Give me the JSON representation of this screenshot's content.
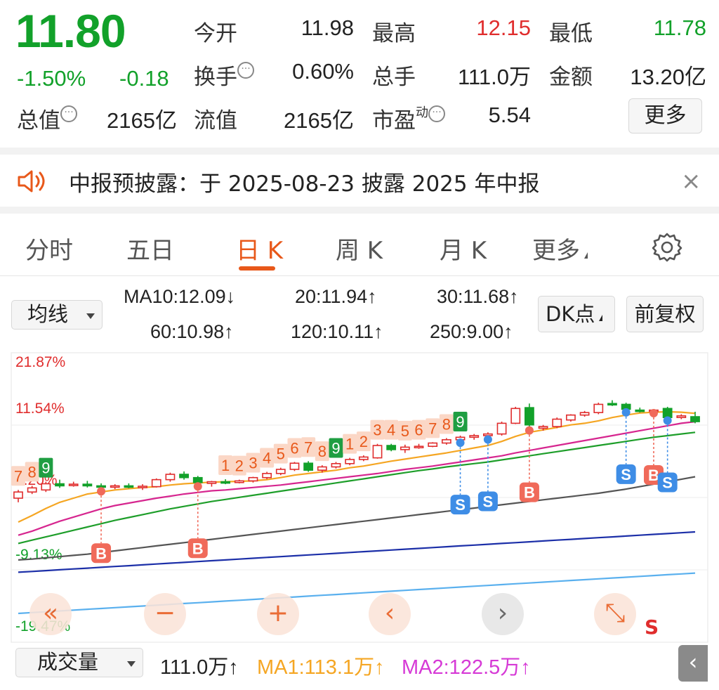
{
  "quote": {
    "price": "11.80",
    "change_pct": "-1.50%",
    "change_amt": "-0.18",
    "fields": [
      {
        "label": "今开",
        "value": "11.98"
      },
      {
        "label": "最高",
        "value": "12.15"
      },
      {
        "label": "最低",
        "value": "11.78"
      },
      {
        "label": "换手",
        "value": "0.60%"
      },
      {
        "label": "总手",
        "value": "111.0万"
      },
      {
        "label": "金额",
        "value": "13.20亿"
      },
      {
        "label": "总值",
        "value": "2165亿"
      },
      {
        "label": "流值",
        "value": "2165亿"
      },
      {
        "label": "市盈",
        "value": "5.54"
      }
    ],
    "pe_superscript": "动",
    "info_glyph": "···",
    "more_label": "更多"
  },
  "notice": {
    "icon": "speaker-icon",
    "text": "中报预披露：于 2025-08-23 披露 2025 年中报",
    "close_glyph": "×"
  },
  "tabs": [
    {
      "label": "分时"
    },
    {
      "label": "五日"
    },
    {
      "label": "日 K",
      "active": true
    },
    {
      "label": "周 K"
    },
    {
      "label": "月 K"
    },
    {
      "label": "更多"
    }
  ],
  "settings_icon": "gear-icon",
  "ma": {
    "select_label": "均线",
    "dk_label": "DK点",
    "adjust_label": "前复权",
    "items": [
      {
        "text": "MA10:12.09↓",
        "color": "#f5a623"
      },
      {
        "text": "20:11.94↑",
        "color": "#d6268f"
      },
      {
        "text": "30:11.68↑",
        "color": "#1e9e2a"
      },
      {
        "text": "60:10.98↑",
        "color": "#555555"
      },
      {
        "text": "120:10.11↑",
        "color": "#1c2fa8"
      },
      {
        "text": "250:9.00↑",
        "color": "#5ab0ee"
      }
    ]
  },
  "chart": {
    "y_labels": [
      "21.87%",
      "11.54%",
      "1.20%",
      "-9.13%",
      "-19.47%"
    ],
    "colors": {
      "up": "#e02d2d",
      "down": "#12a12a"
    },
    "candles": [
      {
        "open": 11.1,
        "high": 11.3,
        "low": 11.0,
        "close": 11.25
      },
      {
        "open": 11.25,
        "high": 11.4,
        "low": 11.2,
        "close": 11.35
      },
      {
        "open": 11.3,
        "high": 11.5,
        "low": 11.25,
        "close": 11.45
      },
      {
        "open": 11.45,
        "high": 11.55,
        "low": 11.35,
        "close": 11.4
      },
      {
        "open": 11.42,
        "high": 11.5,
        "low": 11.38,
        "close": 11.44
      },
      {
        "open": 11.44,
        "high": 11.52,
        "low": 11.36,
        "close": 11.4
      },
      {
        "open": 11.4,
        "high": 11.46,
        "low": 11.3,
        "close": 11.38
      },
      {
        "open": 11.38,
        "high": 11.44,
        "low": 11.32,
        "close": 11.4
      },
      {
        "open": 11.4,
        "high": 11.46,
        "low": 11.34,
        "close": 11.38
      },
      {
        "open": 11.38,
        "high": 11.44,
        "low": 11.3,
        "close": 11.39
      },
      {
        "open": 11.38,
        "high": 11.58,
        "low": 11.36,
        "close": 11.55
      },
      {
        "open": 11.55,
        "high": 11.72,
        "low": 11.5,
        "close": 11.68
      },
      {
        "open": 11.68,
        "high": 11.75,
        "low": 11.55,
        "close": 11.6
      },
      {
        "open": 11.6,
        "high": 11.64,
        "low": 11.42,
        "close": 11.48
      },
      {
        "open": 11.46,
        "high": 11.52,
        "low": 11.38,
        "close": 11.5
      },
      {
        "open": 11.5,
        "high": 11.56,
        "low": 11.44,
        "close": 11.48
      },
      {
        "open": 11.48,
        "high": 11.55,
        "low": 11.46,
        "close": 11.52
      },
      {
        "open": 11.52,
        "high": 11.62,
        "low": 11.48,
        "close": 11.6
      },
      {
        "open": 11.6,
        "high": 11.74,
        "low": 11.56,
        "close": 11.7
      },
      {
        "open": 11.7,
        "high": 11.84,
        "low": 11.66,
        "close": 11.8
      },
      {
        "open": 11.8,
        "high": 11.98,
        "low": 11.76,
        "close": 11.95
      },
      {
        "open": 11.95,
        "high": 12.0,
        "low": 11.74,
        "close": 11.78
      },
      {
        "open": 11.78,
        "high": 11.9,
        "low": 11.72,
        "close": 11.86
      },
      {
        "open": 11.86,
        "high": 11.98,
        "low": 11.82,
        "close": 11.94
      },
      {
        "open": 11.94,
        "high": 12.08,
        "low": 11.9,
        "close": 12.04
      },
      {
        "open": 12.04,
        "high": 12.14,
        "low": 12.0,
        "close": 12.1
      },
      {
        "open": 12.08,
        "high": 12.42,
        "low": 12.06,
        "close": 12.38
      },
      {
        "open": 12.38,
        "high": 12.42,
        "low": 12.24,
        "close": 12.28
      },
      {
        "open": 12.28,
        "high": 12.4,
        "low": 12.2,
        "close": 12.34
      },
      {
        "open": 12.34,
        "high": 12.42,
        "low": 12.3,
        "close": 12.36
      },
      {
        "open": 12.36,
        "high": 12.46,
        "low": 12.34,
        "close": 12.44
      },
      {
        "open": 12.44,
        "high": 12.56,
        "low": 12.4,
        "close": 12.52
      },
      {
        "open": 12.52,
        "high": 12.62,
        "low": 12.48,
        "close": 12.58
      },
      {
        "open": 12.58,
        "high": 12.66,
        "low": 12.52,
        "close": 12.62
      },
      {
        "open": 12.62,
        "high": 12.7,
        "low": 12.56,
        "close": 12.66
      },
      {
        "open": 12.66,
        "high": 12.96,
        "low": 12.62,
        "close": 12.92
      },
      {
        "open": 12.92,
        "high": 13.32,
        "low": 12.9,
        "close": 13.28
      },
      {
        "open": 13.3,
        "high": 13.4,
        "low": 12.78,
        "close": 12.88
      },
      {
        "open": 12.8,
        "high": 12.88,
        "low": 12.74,
        "close": 12.84
      },
      {
        "open": 12.84,
        "high": 13.06,
        "low": 12.8,
        "close": 13.02
      },
      {
        "open": 13.0,
        "high": 13.14,
        "low": 12.96,
        "close": 13.12
      },
      {
        "open": 13.12,
        "high": 13.22,
        "low": 13.08,
        "close": 13.18
      },
      {
        "open": 13.18,
        "high": 13.42,
        "low": 13.14,
        "close": 13.38
      },
      {
        "open": 13.4,
        "high": 13.48,
        "low": 13.34,
        "close": 13.38
      },
      {
        "open": 13.38,
        "high": 13.42,
        "low": 13.22,
        "close": 13.26
      },
      {
        "open": 13.24,
        "high": 13.3,
        "low": 13.18,
        "close": 13.22
      },
      {
        "open": 13.22,
        "high": 13.26,
        "low": 13.2,
        "close": 13.24
      },
      {
        "open": 13.28,
        "high": 13.32,
        "low": 13.02,
        "close": 13.06
      },
      {
        "open": 13.06,
        "high": 13.14,
        "low": 13.02,
        "close": 13.1
      },
      {
        "open": 13.08,
        "high": 13.2,
        "low": 12.92,
        "close": 12.96
      }
    ],
    "ma_lines": [
      {
        "name": "MA10",
        "color": "#f5a623",
        "values": [
          10.52,
          10.68,
          10.85,
          11.0,
          11.1,
          11.2,
          11.25,
          11.3,
          11.33,
          11.36,
          11.38,
          11.42,
          11.45,
          11.47,
          11.49,
          11.5,
          11.51,
          11.52,
          11.55,
          11.6,
          11.66,
          11.7,
          11.74,
          11.78,
          11.84,
          11.88,
          11.94,
          12.0,
          12.05,
          12.1,
          12.15,
          12.2,
          12.26,
          12.32,
          12.38,
          12.48,
          12.6,
          12.7,
          12.76,
          12.82,
          12.88,
          12.92,
          12.98,
          13.06,
          13.12,
          13.17,
          13.19,
          13.2,
          13.19,
          13.16
        ]
      },
      {
        "name": "MA20",
        "color": "#d6268f",
        "values": [
          10.2,
          10.3,
          10.42,
          10.54,
          10.64,
          10.74,
          10.84,
          10.92,
          10.98,
          11.04,
          11.1,
          11.15,
          11.2,
          11.24,
          11.28,
          11.3,
          11.33,
          11.36,
          11.39,
          11.42,
          11.46,
          11.5,
          11.54,
          11.58,
          11.62,
          11.66,
          11.7,
          11.75,
          11.8,
          11.84,
          11.88,
          11.93,
          11.98,
          12.03,
          12.08,
          12.13,
          12.2,
          12.26,
          12.32,
          12.38,
          12.44,
          12.5,
          12.56,
          12.62,
          12.68,
          12.74,
          12.8,
          12.86,
          12.92,
          12.96
        ]
      },
      {
        "name": "MA30",
        "color": "#1e9e2a",
        "values": [
          10.0,
          10.08,
          10.16,
          10.24,
          10.32,
          10.4,
          10.48,
          10.56,
          10.63,
          10.7,
          10.77,
          10.84,
          10.9,
          10.96,
          11.02,
          11.07,
          11.12,
          11.17,
          11.22,
          11.27,
          11.32,
          11.37,
          11.42,
          11.47,
          11.52,
          11.57,
          11.62,
          11.67,
          11.72,
          11.77,
          11.81,
          11.86,
          11.9,
          11.94,
          11.98,
          12.03,
          12.08,
          12.13,
          12.18,
          12.23,
          12.28,
          12.33,
          12.38,
          12.43,
          12.48,
          12.53,
          12.58,
          12.62,
          12.66,
          12.7
        ]
      },
      {
        "name": "MA60",
        "color": "#555555",
        "values": [
          9.6,
          9.62,
          9.65,
          9.68,
          9.71,
          9.74,
          9.78,
          9.82,
          9.86,
          9.9,
          9.94,
          9.98,
          10.02,
          10.06,
          10.1,
          10.14,
          10.18,
          10.22,
          10.26,
          10.3,
          10.34,
          10.38,
          10.42,
          10.46,
          10.5,
          10.54,
          10.58,
          10.62,
          10.66,
          10.7,
          10.74,
          10.78,
          10.82,
          10.86,
          10.9,
          10.94,
          10.98,
          11.02,
          11.06,
          11.1,
          11.14,
          11.18,
          11.22,
          11.27,
          11.32,
          11.38,
          11.44,
          11.5,
          11.56,
          11.62
        ]
      },
      {
        "name": "MA120",
        "color": "#1c2fa8",
        "values": [
          9.3,
          9.32,
          9.34,
          9.36,
          9.38,
          9.4,
          9.42,
          9.44,
          9.46,
          9.48,
          9.5,
          9.52,
          9.54,
          9.56,
          9.58,
          9.6,
          9.62,
          9.64,
          9.66,
          9.68,
          9.7,
          9.72,
          9.74,
          9.76,
          9.78,
          9.8,
          9.82,
          9.84,
          9.86,
          9.88,
          9.9,
          9.92,
          9.94,
          9.96,
          9.98,
          10.0,
          10.02,
          10.04,
          10.06,
          10.08,
          10.1,
          10.12,
          10.14,
          10.16,
          10.18,
          10.2,
          10.22,
          10.24,
          10.26,
          10.28
        ]
      },
      {
        "name": "MA250",
        "color": "#5ab0ee",
        "values": [
          8.3,
          8.32,
          8.34,
          8.36,
          8.38,
          8.4,
          8.42,
          8.44,
          8.46,
          8.48,
          8.5,
          8.52,
          8.54,
          8.56,
          8.58,
          8.6,
          8.62,
          8.64,
          8.66,
          8.68,
          8.7,
          8.72,
          8.74,
          8.76,
          8.78,
          8.8,
          8.82,
          8.84,
          8.86,
          8.88,
          8.9,
          8.92,
          8.94,
          8.96,
          8.98,
          9.0,
          9.02,
          9.04,
          9.06,
          9.08,
          9.1,
          9.12,
          9.14,
          9.16,
          9.18,
          9.2,
          9.22,
          9.24,
          9.26,
          9.28
        ]
      }
    ],
    "td_counts": [
      {
        "i": 0,
        "n": "7",
        "up": true
      },
      {
        "i": 1,
        "n": "8",
        "up": true
      },
      {
        "i": 2,
        "n": "9",
        "up": false
      },
      {
        "i": 15,
        "n": "1",
        "up": true
      },
      {
        "i": 16,
        "n": "2",
        "up": true
      },
      {
        "i": 17,
        "n": "3",
        "up": true
      },
      {
        "i": 18,
        "n": "4",
        "up": true
      },
      {
        "i": 19,
        "n": "5",
        "up": true
      },
      {
        "i": 20,
        "n": "6",
        "up": true
      },
      {
        "i": 21,
        "n": "7",
        "up": true
      },
      {
        "i": 22,
        "n": "8",
        "up": true
      },
      {
        "i": 23,
        "n": "9",
        "up": false
      },
      {
        "i": 24,
        "n": "1",
        "up": true
      },
      {
        "i": 25,
        "n": "2",
        "up": true
      },
      {
        "i": 26,
        "n": "3",
        "up": true
      },
      {
        "i": 27,
        "n": "4",
        "up": true
      },
      {
        "i": 28,
        "n": "5",
        "up": true
      },
      {
        "i": 29,
        "n": "6",
        "up": true
      },
      {
        "i": 30,
        "n": "7",
        "up": true
      },
      {
        "i": 31,
        "n": "8",
        "up": true
      },
      {
        "i": 32,
        "n": "9",
        "up": false
      }
    ],
    "signals": [
      {
        "i": 6,
        "label": "B"
      },
      {
        "i": 13,
        "label": "B"
      },
      {
        "i": 32,
        "label": "S"
      },
      {
        "i": 34,
        "label": "S"
      },
      {
        "i": 37,
        "label": "B"
      },
      {
        "i": 44,
        "label": "S"
      },
      {
        "i": 46,
        "label": "B"
      },
      {
        "i": 47,
        "label": "S"
      }
    ],
    "controls": [
      {
        "name": "zoom-out-far-button",
        "glyph": "«"
      },
      {
        "name": "zoom-out-button",
        "glyph": "−"
      },
      {
        "name": "zoom-in-button",
        "glyph": "+"
      },
      {
        "name": "move-left-button",
        "glyph": "‹"
      },
      {
        "name": "move-right-button",
        "glyph": "›"
      },
      {
        "name": "fullscreen-button",
        "glyph": "⤡"
      }
    ],
    "corner_s": "S"
  },
  "volume": {
    "select_label": "成交量",
    "value": "111.0万↑",
    "ma1": "MA1:113.1万↑",
    "ma2": "MA2:122.5万↑",
    "ma1_color": "#f5a623",
    "ma2_color": "#d63ad6",
    "side_glyph": "‹"
  }
}
